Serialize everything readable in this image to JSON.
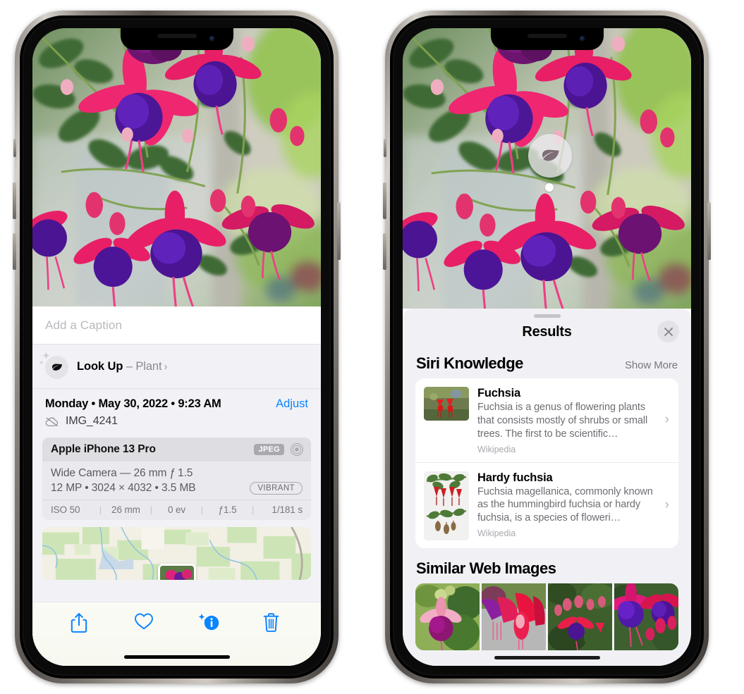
{
  "left_phone": {
    "caption": {
      "placeholder": "Add a Caption",
      "value": ""
    },
    "lookup": {
      "label": "Look Up",
      "dash": "–",
      "subject": "Plant",
      "chevron": "›",
      "icon": "leaf-icon"
    },
    "date_row": {
      "weekday": "Monday",
      "separator": "•",
      "date": "May 30, 2022",
      "time": "9:23 AM",
      "full": "Monday • May 30, 2022 • 9:23 AM",
      "adjust_label": "Adjust"
    },
    "file_row": {
      "icon": "icloud-slash-icon",
      "filename": "IMG_4241"
    },
    "exif": {
      "device": "Apple iPhone 13 Pro",
      "format_badge": "JPEG",
      "aperture_icon": "aperture-icon",
      "lens": "Wide Camera — 26 mm ƒ 1.5",
      "size_line": "12 MP • 3024 × 4032 • 3.5 MB",
      "style_badge": "VIBRANT",
      "stats": [
        "ISO 50",
        "26 mm",
        "0 ev",
        "ƒ1.5",
        "1/181 s"
      ],
      "separator": "|"
    },
    "map": {
      "name": "location-map-thumbnail"
    },
    "toolbar": {
      "items": [
        {
          "name": "share-button",
          "icon": "share-icon",
          "label": "Share"
        },
        {
          "name": "favorite-button",
          "icon": "heart-icon",
          "label": "Favorite"
        },
        {
          "name": "info-button",
          "icon": "info-sparkle-icon",
          "label": "Info",
          "active": true
        },
        {
          "name": "delete-button",
          "icon": "trash-icon",
          "label": "Delete"
        }
      ]
    }
  },
  "right_phone": {
    "visual_lookup_badge": {
      "icon": "leaf-icon",
      "label": "Visual Look Up"
    },
    "sheet": {
      "title": "Results",
      "close_label": "✕"
    },
    "siri_knowledge": {
      "title": "Siri Knowledge",
      "action": "Show More",
      "cards": [
        {
          "title": "Fuchsia",
          "description": "Fuchsia is a genus of flowering plants that consists mostly of shrubs or small trees. The first to be scientific…",
          "source": "Wikipedia",
          "chevron": "›",
          "thumb": "fuchsia-thumbnail"
        },
        {
          "title": "Hardy fuchsia",
          "description": "Fuchsia magellanica, commonly known as the hummingbird fuchsia or hardy fuchsia, is a species of floweri…",
          "source": "Wikipedia",
          "chevron": "›",
          "thumb": "hardy-fuchsia-thumbnail"
        }
      ]
    },
    "similar_web_images": {
      "title": "Similar Web Images",
      "images": [
        {
          "name": "web-image-1",
          "alt": "pink and magenta fuchsia with green leaves"
        },
        {
          "name": "web-image-2",
          "alt": "close-up red fuchsia blossoms"
        },
        {
          "name": "web-image-3",
          "alt": "fuchsia shrub with red and purple flowers"
        },
        {
          "name": "web-image-4",
          "alt": "purple and red double fuchsia flowers"
        }
      ]
    }
  },
  "colors": {
    "accent_blue": "#0a84ff",
    "panel_bg": "#f2f2f6",
    "sheet_bg": "#f1f1f5",
    "card_bg": "#ffffff",
    "secondary_text": "#6e6e74",
    "tertiary_text": "#a9a9af"
  }
}
